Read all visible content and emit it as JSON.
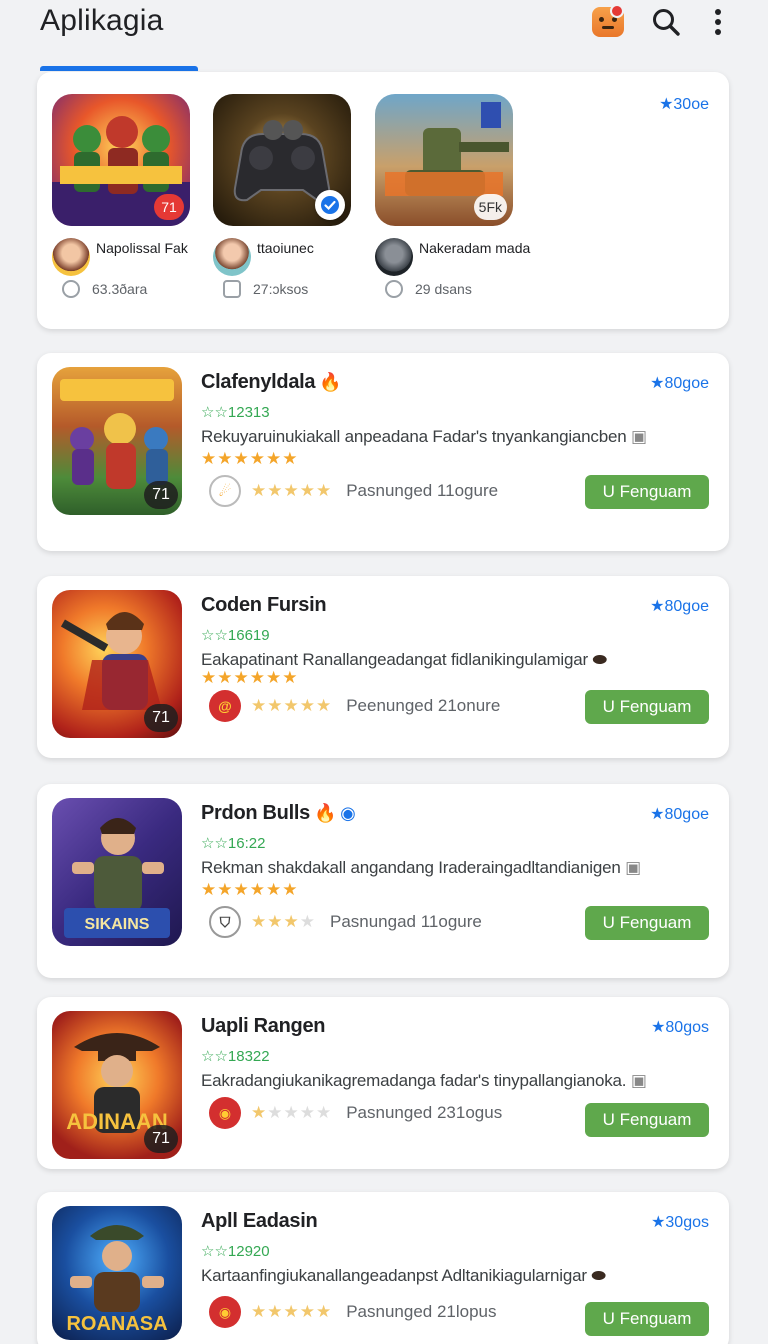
{
  "header": {
    "title": "Aplikagia",
    "icons": [
      "avatar-icon",
      "search-icon",
      "more-vert-icon"
    ]
  },
  "featured": {
    "rating": "★30oe",
    "items": [
      {
        "badge": "71",
        "author": "Napolissal Fak",
        "meta": "63.3ðara"
      },
      {
        "badge": "",
        "author": "ttaoiunec",
        "meta": "27:ɔksos"
      },
      {
        "badge": "5Fk",
        "author": "Nakeradam mada",
        "meta": "29 dsans"
      }
    ]
  },
  "apps": [
    {
      "name": "Clafenyldala",
      "sub": "☆☆12313",
      "desc": "Rekuyaruinukiakall anpeadana Fadar's tnyankangiancben",
      "stars": "★★★★★★",
      "dev": "Pasnunged 11ogure",
      "rating": "★80goe",
      "install": "U Fenguam",
      "age": "71"
    },
    {
      "name": "Coden Fursin",
      "sub": "☆☆16619",
      "desc": "Eakapatinant Ranallangeadangat fidlanikingulamigar",
      "stars": "★★★★★★",
      "dev": "Peenunged 21onure",
      "rating": "★80goe",
      "install": "U Fenguam",
      "age": "71"
    },
    {
      "name": "Prdon Bulls",
      "sub": "☆☆16:22",
      "desc": "Rekman shakdakall angandang Iraderaingadltandianigen",
      "stars": "★★★★★★",
      "dev": "Pasnungad 11ogure",
      "rating": "★80goe",
      "install": "U Fenguam",
      "age": ""
    },
    {
      "name": "Uapli Rangen",
      "sub": "☆☆18322",
      "desc": "Eakradangiukanikagremadanga fadar's tinypallangianoka.",
      "stars": "",
      "dev": "Pasnunged 231ogus",
      "rating": "★80gos",
      "install": "U Fenguam",
      "age": "71"
    },
    {
      "name": "Apll Eadasin",
      "sub": "☆☆12920",
      "desc": "Kartaanfingiukanallangeadanpst Adltanikiagularnigar",
      "stars": "",
      "dev": "Pasnunged 21lopus",
      "rating": "★30gos",
      "install": "U Fenguam",
      "age": ""
    }
  ]
}
